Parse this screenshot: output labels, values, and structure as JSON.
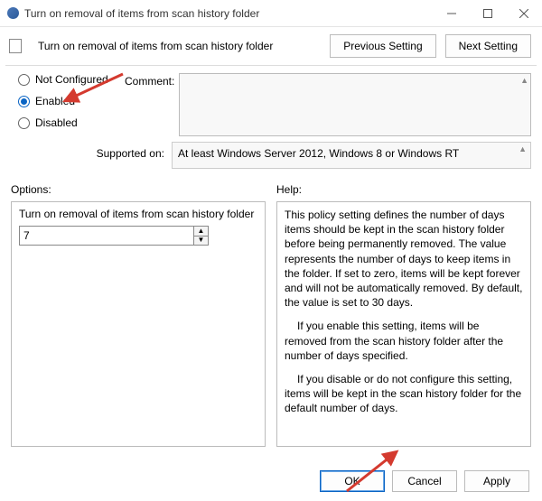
{
  "window": {
    "title": "Turn on removal of items from scan history folder"
  },
  "header": {
    "policy_title": "Turn on removal of items from scan history folder",
    "prev_btn": "Previous Setting",
    "next_btn": "Next Setting"
  },
  "state": {
    "not_configured": "Not Configured",
    "enabled": "Enabled",
    "disabled": "Disabled",
    "selected": "enabled",
    "comment_label": "Comment:",
    "comment_value": ""
  },
  "supported": {
    "label": "Supported on:",
    "value": "At least Windows Server 2012, Windows 8 or Windows RT"
  },
  "options": {
    "label": "Options:",
    "option_title": "Turn on removal of items from scan history folder",
    "value": "7"
  },
  "help": {
    "label": "Help:",
    "p1": "This policy setting defines the number of days items should be kept in the scan history folder before being permanently removed. The value represents the number of days to keep items in the folder. If set to zero, items will be kept forever and will not be automatically removed. By default, the value is set to 30 days.",
    "p2": "If you enable this setting, items will be removed from the scan history folder after the number of days specified.",
    "p3": "If you disable or do not configure this setting, items will be kept in the scan history folder for the default number of days."
  },
  "actions": {
    "ok": "OK",
    "cancel": "Cancel",
    "apply": "Apply"
  },
  "colors": {
    "accent": "#0a64c4",
    "arrow": "#d43a2f"
  }
}
